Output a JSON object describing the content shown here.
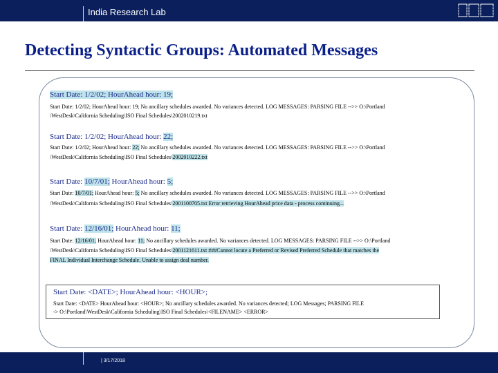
{
  "header": {
    "lab": "India Research Lab",
    "logo": "IBM"
  },
  "slide": {
    "title": "Detecting Syntactic Groups: Automated Messages"
  },
  "examples": [
    {
      "hd_a": "Start Date: 1/2/02; HourAhead hour: 19;",
      "l1": "Start Date: 1/2/02; HourAhead hour: 19; No ancillary schedules awarded. No variances detected. LOG MESSAGES: PARSING FILE -->> O:\\Portland",
      "l2": "\\WestDesk\\California Scheduling\\ISO Final Schedules\\2002010219.txt"
    },
    {
      "hd_a": "Start Date: 1/2/02; HourAhead hour: ",
      "hd_b": "22;",
      "l1_a": "Start Date: 1/2/02; HourAhead hour: ",
      "l1_b": "22;",
      "l1_c": " No ancillary schedules awarded. No variances detected. LOG MESSAGES: PARSING FILE -->> O:\\Portland",
      "l2_a": "\\WestDesk\\California Scheduling\\ISO Final Schedules\\",
      "l2_b": "2002010222.txt"
    },
    {
      "hd_a": "Start Date: ",
      "hd_b": "10/7/01;",
      "hd_c": " HourAhead hour: ",
      "hd_d": "5;",
      "l1_a": "Start Date: ",
      "l1_b": "10/7/01;",
      "l1_c": " HourAhead hour: ",
      "l1_d": "5;",
      "l1_e": " No ancillary schedules awarded. No variances detected. LOG MESSAGES: PARSING FILE -->> O:\\Portland",
      "l2_a": "\\WestDesk\\California Scheduling\\ISO Final Schedules\\",
      "l2_b": "2001100705.txt Error retrieving HourAhead price data - process continuing..."
    },
    {
      "hd_a": "Start Date: ",
      "hd_b": "12/16/01;",
      "hd_c": " HourAhead hour: ",
      "hd_d": "11;",
      "l1_a": "Start Date: ",
      "l1_b": "12/16/01;",
      "l1_c": " HourAhead hour: ",
      "l1_d": "11;",
      "l1_e": " No ancillary schedules awarded. No variances detected. LOG MESSAGES: PARSING FILE -->> O:\\Portland",
      "l2_a": "\\WestDesk\\California Scheduling\\ISO Final Schedules\\",
      "l2_b": "2001121611.txt ###Cannot locate a Preferred or Revised Preferred Schedule that matches the",
      "l3": "FINAL Individual Interchange Schedule. Unable to assign deal number."
    }
  ],
  "generalized": {
    "head": "Start Date: <DATE>; HourAhead hour: <HOUR>;",
    "line1": "Start Date: <DATE> HourAhead hour: <HOUR>; No ancillary schedules awarded. No variances detected; LOG Messages; PARSING FILE",
    "line2": "-> O:\\Portland\\WestDesk\\California Scheduling\\ISO Final Schedules\\<FILENAME> <ERROR>"
  },
  "footer": {
    "date": "| 3/17/2018"
  }
}
